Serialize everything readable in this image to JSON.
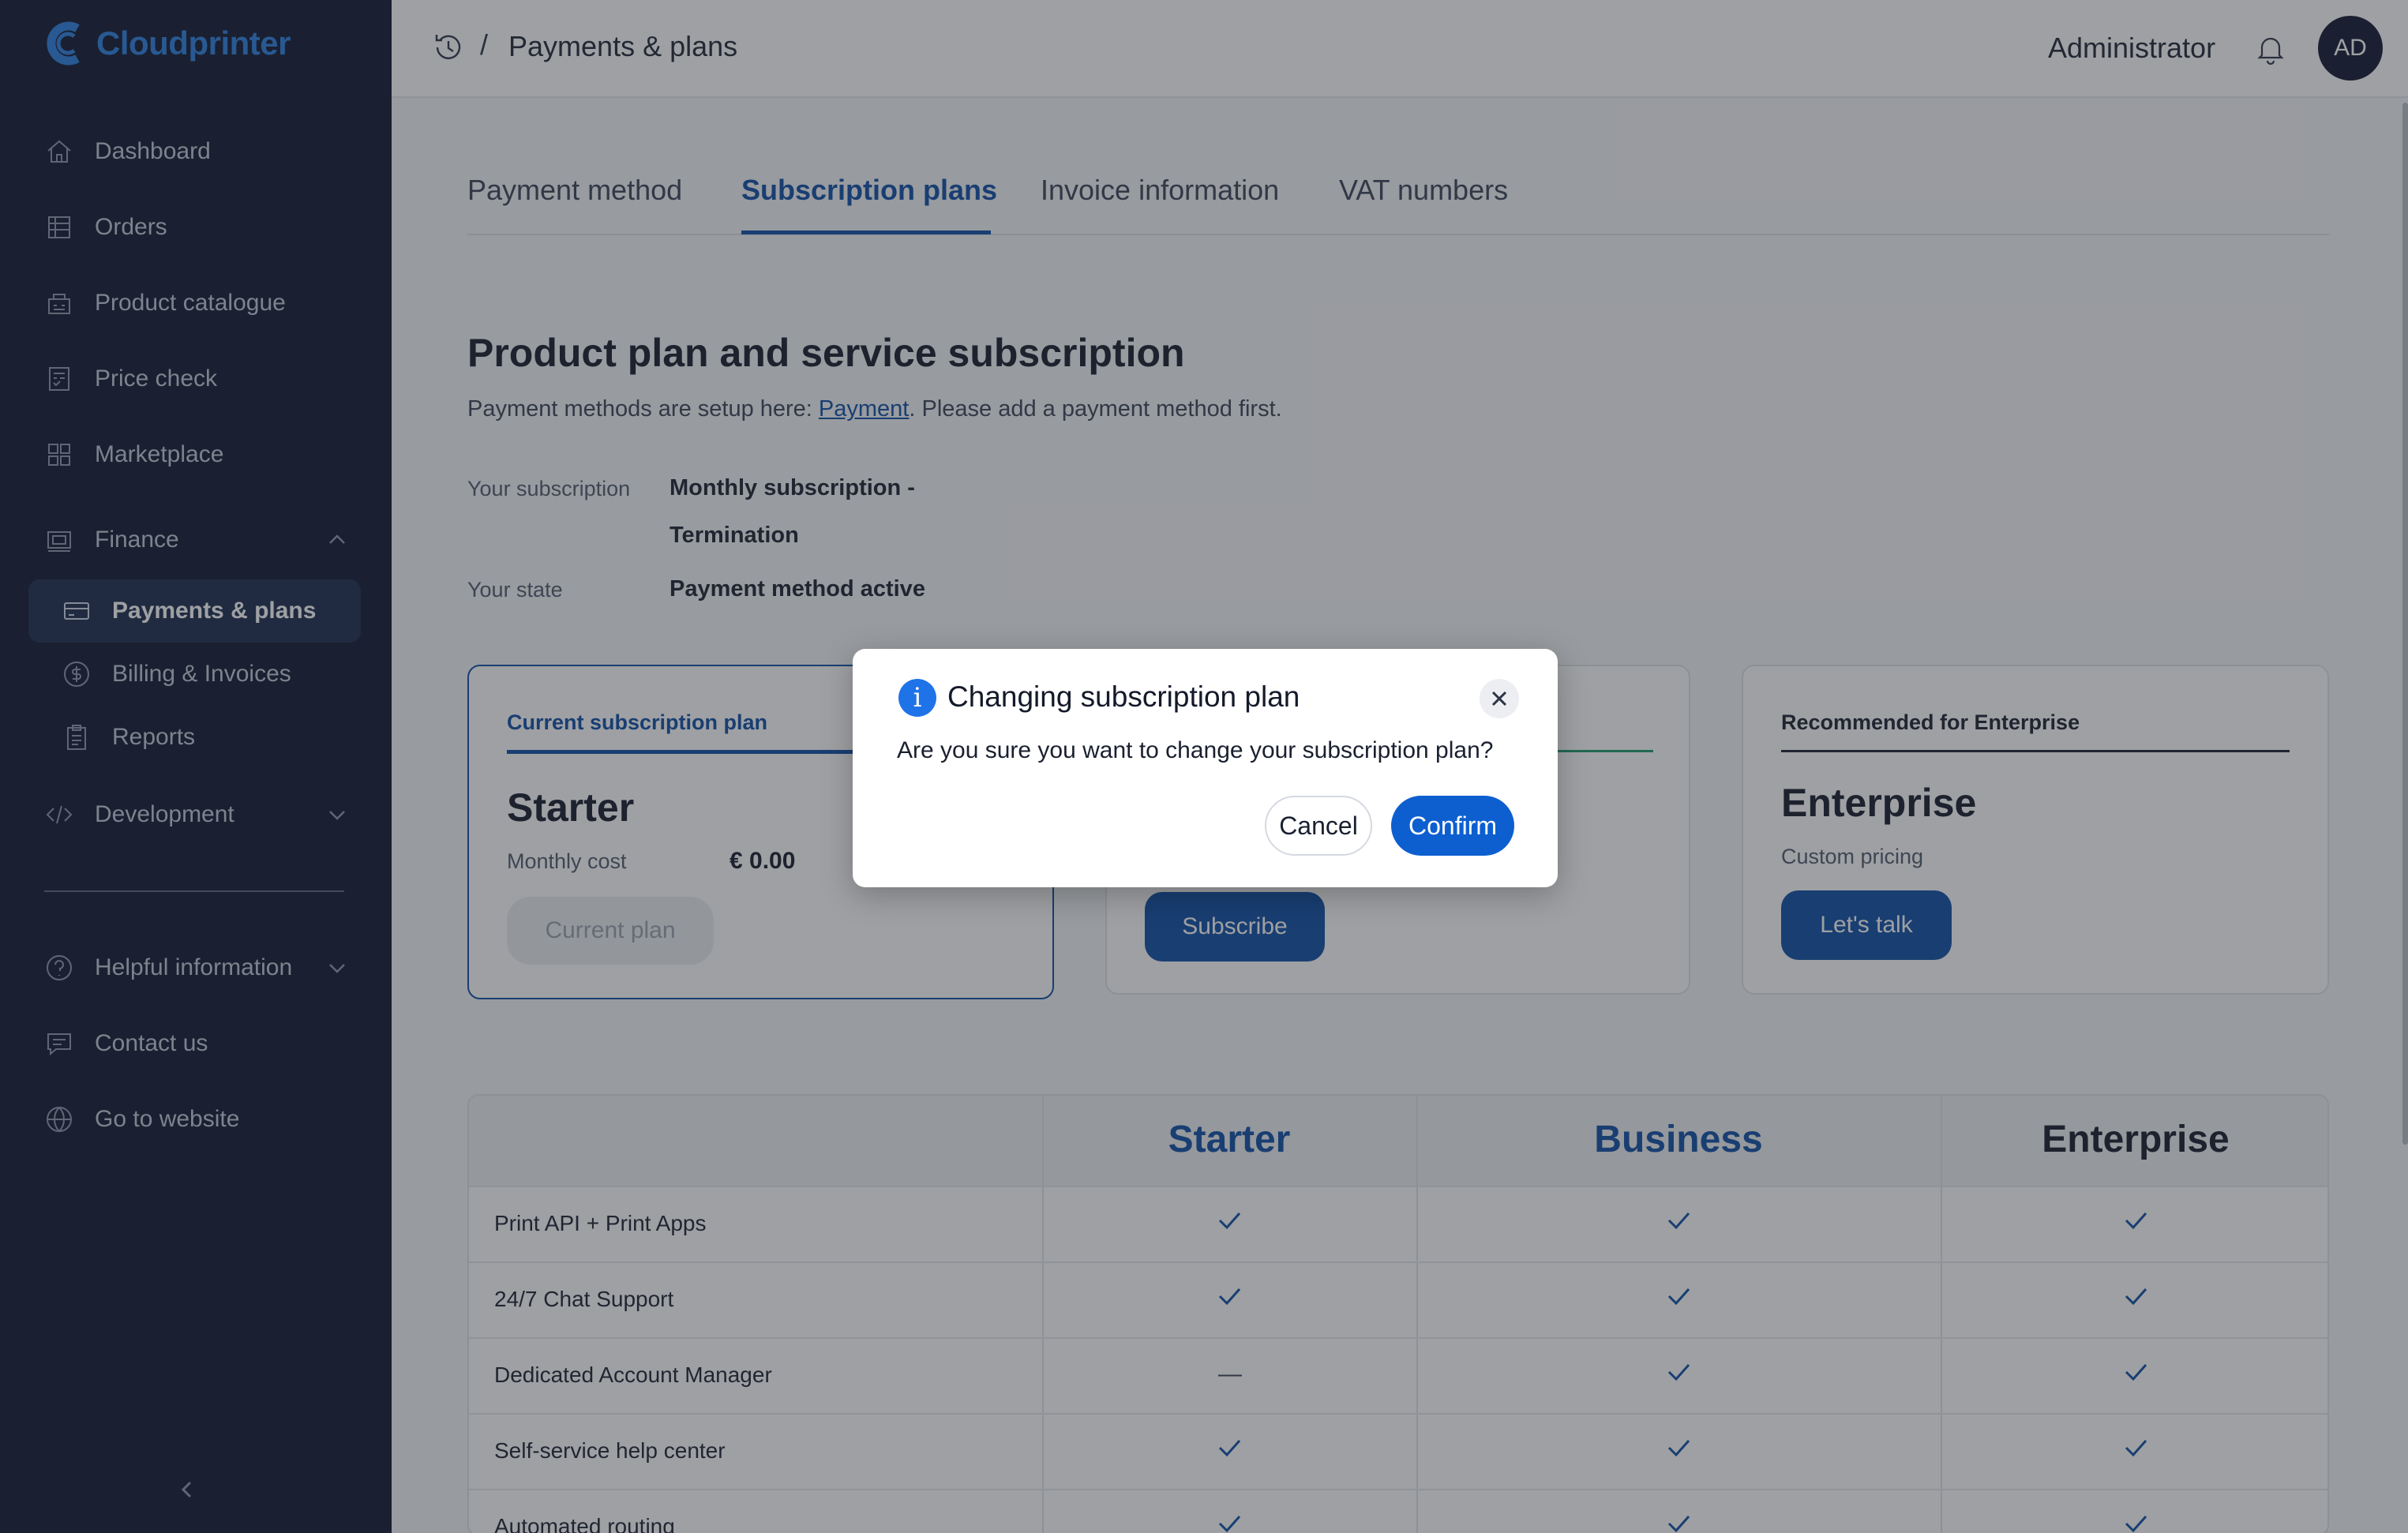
{
  "brand": {
    "name": "Cloudprinter"
  },
  "sidebar": {
    "items": [
      {
        "label": "Dashboard",
        "icon": "home-icon"
      },
      {
        "label": "Orders",
        "icon": "orders-icon"
      },
      {
        "label": "Product catalogue",
        "icon": "catalogue-icon"
      },
      {
        "label": "Price check",
        "icon": "price-check-icon"
      },
      {
        "label": "Marketplace",
        "icon": "marketplace-icon"
      },
      {
        "label": "Finance",
        "icon": "finance-icon",
        "expanded": true
      },
      {
        "label": "Development",
        "icon": "code-icon",
        "expanded": false
      },
      {
        "label": "Helpful information",
        "icon": "help-icon",
        "expanded": false
      },
      {
        "label": "Contact us",
        "icon": "chat-icon"
      },
      {
        "label": "Go to website",
        "icon": "globe-icon"
      }
    ],
    "finance_sub": [
      {
        "label": "Payments & plans",
        "icon": "card-icon",
        "active": true
      },
      {
        "label": "Billing & Invoices",
        "icon": "dollar-icon"
      },
      {
        "label": "Reports",
        "icon": "clipboard-icon"
      }
    ]
  },
  "header": {
    "breadcrumb_sep": "/",
    "breadcrumb": "Payments & plans",
    "user": "Administrator",
    "avatar_initials": "AD"
  },
  "tabs": [
    {
      "label": "Payment method"
    },
    {
      "label": "Subscription plans",
      "active": true
    },
    {
      "label": "Invoice information"
    },
    {
      "label": "VAT numbers"
    }
  ],
  "main": {
    "title": "Product plan and service subscription",
    "subtitle_prefix": "Payment methods are setup here: ",
    "subtitle_link": "Payment",
    "subtitle_suffix": ". Please add a payment method first.",
    "subscription_label": "Your subscription",
    "subscription_value_line1": "Monthly subscription -",
    "subscription_value_line2": "Termination",
    "state_label": "Your state",
    "state_value": "Payment method active"
  },
  "cards": {
    "current": {
      "tag": "Current subscription plan",
      "title": "Starter",
      "cost_label": "Monthly cost",
      "cost": "€ 0.00",
      "button": "Current plan"
    },
    "business": {
      "button": "Subscribe"
    },
    "enterprise": {
      "tag": "Recommended for Enterprise",
      "title": "Enterprise",
      "pricing": "Custom pricing",
      "button": "Let's talk"
    }
  },
  "table": {
    "columns": [
      "Starter",
      "Business",
      "Enterprise"
    ],
    "column_colors": [
      "#0d4ea6",
      "#0d4ea6",
      "#141a2a"
    ],
    "rows": [
      {
        "feature": "Print API + Print Apps",
        "values": [
          "check",
          "check",
          "check"
        ]
      },
      {
        "feature": "24/7 Chat Support",
        "values": [
          "check",
          "check",
          "check"
        ]
      },
      {
        "feature": "Dedicated Account Manager",
        "values": [
          "—",
          "check",
          "check"
        ]
      },
      {
        "feature": "Self-service help center",
        "values": [
          "check",
          "check",
          "check"
        ]
      },
      {
        "feature": "Automated routing",
        "values": [
          "check",
          "check",
          "check"
        ]
      }
    ]
  },
  "modal": {
    "title": "Changing subscription plan",
    "body": "Are you sure you want to change your subscription plan?",
    "cancel": "Cancel",
    "confirm": "Confirm",
    "info_glyph": "i"
  }
}
